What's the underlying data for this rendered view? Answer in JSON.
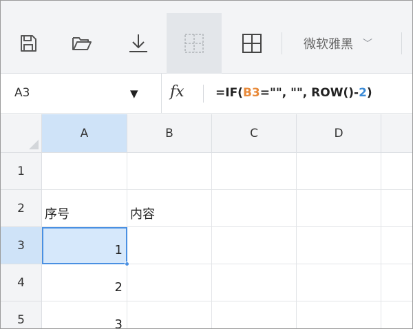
{
  "toolbar": {
    "buttons": [
      {
        "name": "save-button",
        "icon": "save-icon"
      },
      {
        "name": "open-button",
        "icon": "folder-open-icon"
      },
      {
        "name": "download-button",
        "icon": "download-icon"
      },
      {
        "name": "no-border-button",
        "icon": "border-none-icon",
        "active": true
      },
      {
        "name": "all-borders-button",
        "icon": "border-all-icon"
      }
    ],
    "font_family": "微软雅黑",
    "font_dropdown_icon": "chevron-down-icon"
  },
  "formula_bar": {
    "cell_ref": "A3",
    "dropdown_icon": "caret-down-icon",
    "fx_label": "fx",
    "formula_parts": {
      "p1": "=IF(",
      "ref": "B3",
      "p2": "=\"\", \"\", ROW()-",
      "num": "2",
      "p3": ")"
    }
  },
  "sheet": {
    "columns": [
      "A",
      "B",
      "C",
      "D"
    ],
    "rows": [
      "1",
      "2",
      "3",
      "4",
      "5"
    ],
    "selected_cell": "A3",
    "cells": {
      "A1": "",
      "B1": "",
      "A2": "序号",
      "B2": "内容",
      "A3": "1",
      "A4": "2",
      "A5": "3"
    }
  },
  "colors": {
    "selection": "#4a90e2",
    "selected_header": "#cfe3f8",
    "formula_ref": "#e88a3a",
    "formula_number": "#3a8ad6"
  }
}
